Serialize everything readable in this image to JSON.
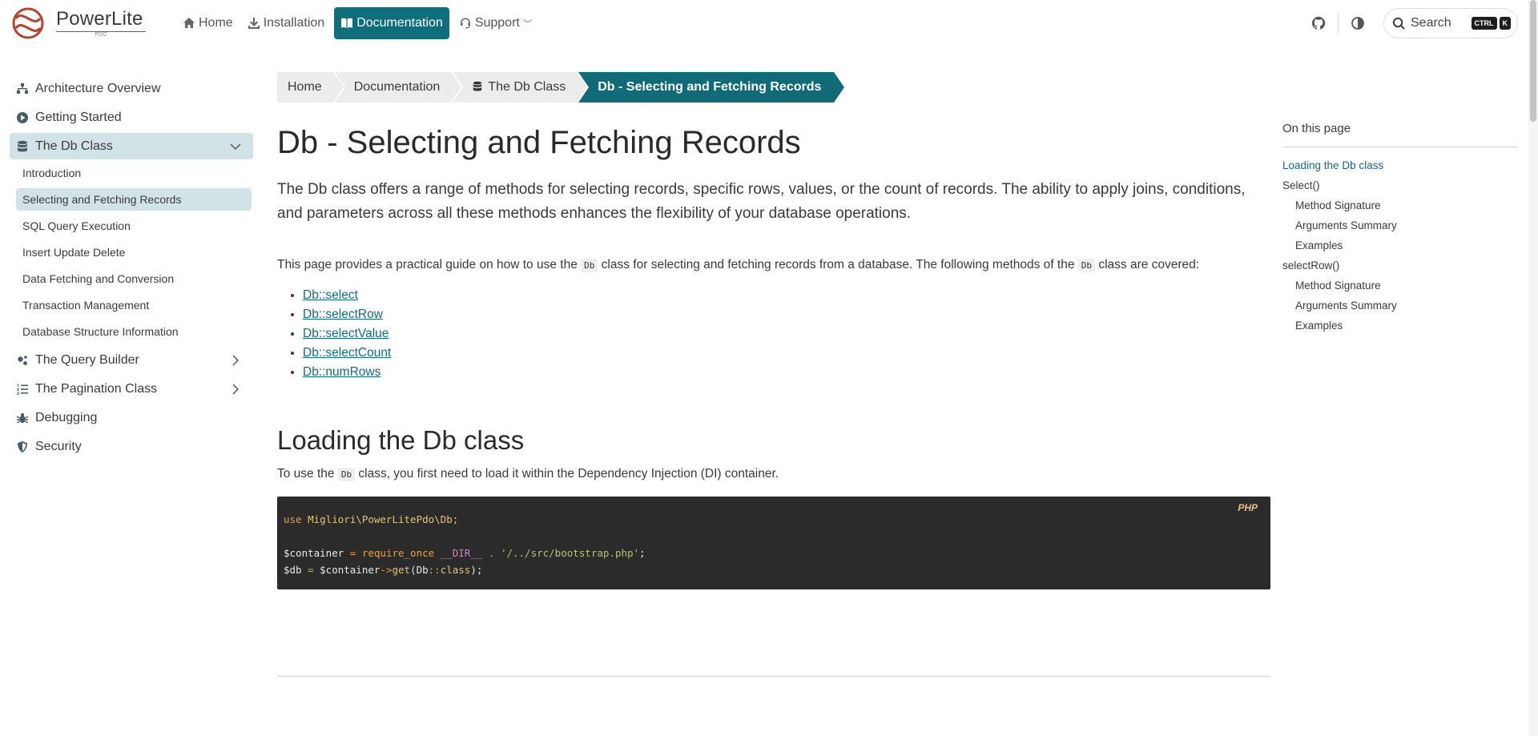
{
  "brand": {
    "name": "PowerLite",
    "sub": "PDO",
    "accent": "#0f6e7c",
    "logo_color": "#b5432f"
  },
  "nav": {
    "items": [
      {
        "label": "Home",
        "icon": "home-icon"
      },
      {
        "label": "Installation",
        "icon": "download-icon"
      },
      {
        "label": "Documentation",
        "icon": "book-icon",
        "active": true
      },
      {
        "label": "Support",
        "icon": "headset-icon",
        "caret": "﹀"
      }
    ]
  },
  "tools": {
    "github_icon": "github-icon",
    "theme_icon": "contrast-icon",
    "search_label": "Search",
    "shortcut_ctrl": "CTRL",
    "shortcut_key": "K"
  },
  "sidebar": {
    "items": [
      {
        "label": "Architecture Overview",
        "icon": "sitemap-icon"
      },
      {
        "label": "Getting Started",
        "icon": "play-circle-icon"
      },
      {
        "label": "The Db Class",
        "icon": "database-icon",
        "expanded": true
      },
      {
        "label": "The Query Builder",
        "icon": "gears-icon"
      },
      {
        "label": "The Pagination Class",
        "icon": "list-ol-icon"
      },
      {
        "label": "Debugging",
        "icon": "bug-icon"
      },
      {
        "label": "Security",
        "icon": "shield-icon"
      }
    ],
    "sub_items": [
      "Introduction",
      "Selecting and Fetching Records",
      "SQL Query Execution",
      "Insert Update Delete",
      "Data Fetching and Conversion",
      "Transaction Management",
      "Database Structure Information"
    ]
  },
  "breadcrumb": [
    "Home",
    "Documentation",
    "The Db Class",
    "Db - Selecting and Fetching Records"
  ],
  "main": {
    "title": "Db - Selecting and Fetching Records",
    "lead": "The Db class offers a range of methods for selecting records, specific rows, values, or the count of records. The ability to apply joins, conditions, and parameters across all these methods enhances the flexibility of your database operations.",
    "intro_pre": "This page provides a practical guide on how to use the ",
    "intro_code": "Db",
    "intro_mid": " class for selecting and fetching records from a database. The following methods of the ",
    "intro_post": " class are covered:",
    "links": [
      "Db::select",
      "Db::selectRow",
      "Db::selectValue",
      "Db::selectCount",
      "Db::numRows"
    ],
    "section_title": "Loading the Db class",
    "section_pre": "To use the ",
    "section_code": "Db",
    "section_post": " class, you first need to load it within the Dependency Injection (DI) container.",
    "code": {
      "lang": "PHP",
      "l1_kw": "use",
      "l1_ns": " Migliori\\PowerLitePdo\\Db;",
      "l3_var": "$container",
      "l3_eq": " = ",
      "l3_fn": "require_once",
      "l3_dir": " __DIR__ ",
      "l3_dot": ". ",
      "l3_str": "'/../src/bootstrap.php'",
      "l3_end": ";",
      "l4_var": "$db",
      "l4_eq": " = ",
      "l4_obj": "$container",
      "l4_arrow": "->",
      "l4_fn": "get",
      "l4_args": "(Db",
      "l4_dc": "::",
      "l4_cls": "class",
      "l4_end": ");"
    }
  },
  "toc": {
    "title": "On this page",
    "items": [
      {
        "label": "Loading the Db class",
        "level": 1,
        "active": true
      },
      {
        "label": "Select()",
        "level": 1
      },
      {
        "label": "Method Signature",
        "level": 2
      },
      {
        "label": "Arguments Summary",
        "level": 2
      },
      {
        "label": "Examples",
        "level": 2
      },
      {
        "label": "selectRow()",
        "level": 1
      },
      {
        "label": "Method Signature",
        "level": 2
      },
      {
        "label": "Arguments Summary",
        "level": 2
      },
      {
        "label": "Examples",
        "level": 2
      }
    ]
  }
}
